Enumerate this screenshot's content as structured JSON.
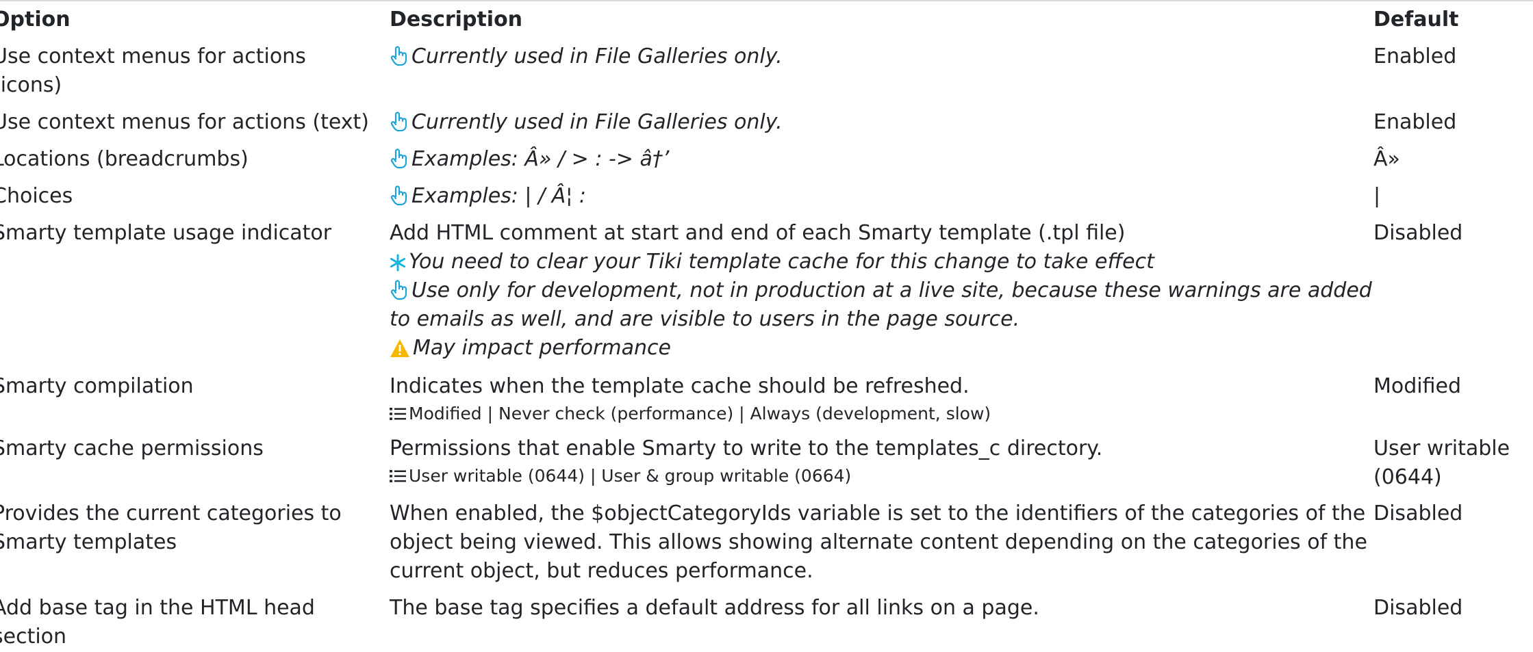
{
  "header": {
    "option": "Option",
    "description": "Description",
    "default": "Default"
  },
  "rows": [
    {
      "option": [
        "Use context menus for actions",
        "(icons)"
      ],
      "tip": "Currently used in File Galleries only.",
      "default": [
        "Enabled"
      ]
    },
    {
      "option": [
        "Use context menus for actions (text)"
      ],
      "tip": "Currently used in File Galleries only.",
      "default": [
        "Enabled"
      ]
    },
    {
      "option": [
        "Locations (breadcrumbs)"
      ],
      "tip": "Examples: Â» / > : -> â†’",
      "default": [
        "Â»"
      ]
    },
    {
      "option": [
        "Choices"
      ],
      "tip": "Examples: | / Â¦ :",
      "default": [
        "|"
      ]
    },
    {
      "option": [
        "Smarty template usage indicator"
      ],
      "description": "Add HTML comment at start and end of each Smarty template (.tpl file)",
      "warning_cache": "You need to clear your Tiki template cache for this change to take effect",
      "tip": [
        "Use only for development, not in production at a live site, because these warnings are added",
        "to emails as well, and are visible to users in the page source."
      ],
      "perf": "May impact performance",
      "default": [
        "Disabled"
      ]
    },
    {
      "option": [
        "Smarty compilation"
      ],
      "description": "Indicates when the template cache should be refreshed.",
      "choices": "Modified | Never check (performance) | Always (development, slow)",
      "default": [
        "Modified"
      ]
    },
    {
      "option": [
        "Smarty cache permissions"
      ],
      "description": "Permissions that enable Smarty to write to the templates_c directory.",
      "choices": "User writable (0644) | User & group writable (0664)",
      "default": [
        "User writable",
        "(0644)"
      ]
    },
    {
      "option": [
        "Provides the current categories to",
        "Smarty templates"
      ],
      "description": [
        "When enabled, the $objectCategoryIds variable is set to the identifiers of the categories of the",
        "object being viewed. This allows showing alternate content depending on the categories of the",
        "current object, but reduces performance."
      ],
      "default": [
        "Disabled"
      ]
    },
    {
      "option": [
        "Add base tag in the HTML head",
        "section"
      ],
      "description": "The base tag specifies a default address for all links on a page.",
      "default": [
        "Disabled"
      ]
    }
  ],
  "colors": {
    "tip_icon": "#1ba3d6",
    "asterisk": "#17b3e0",
    "warning": "#f5b800"
  }
}
